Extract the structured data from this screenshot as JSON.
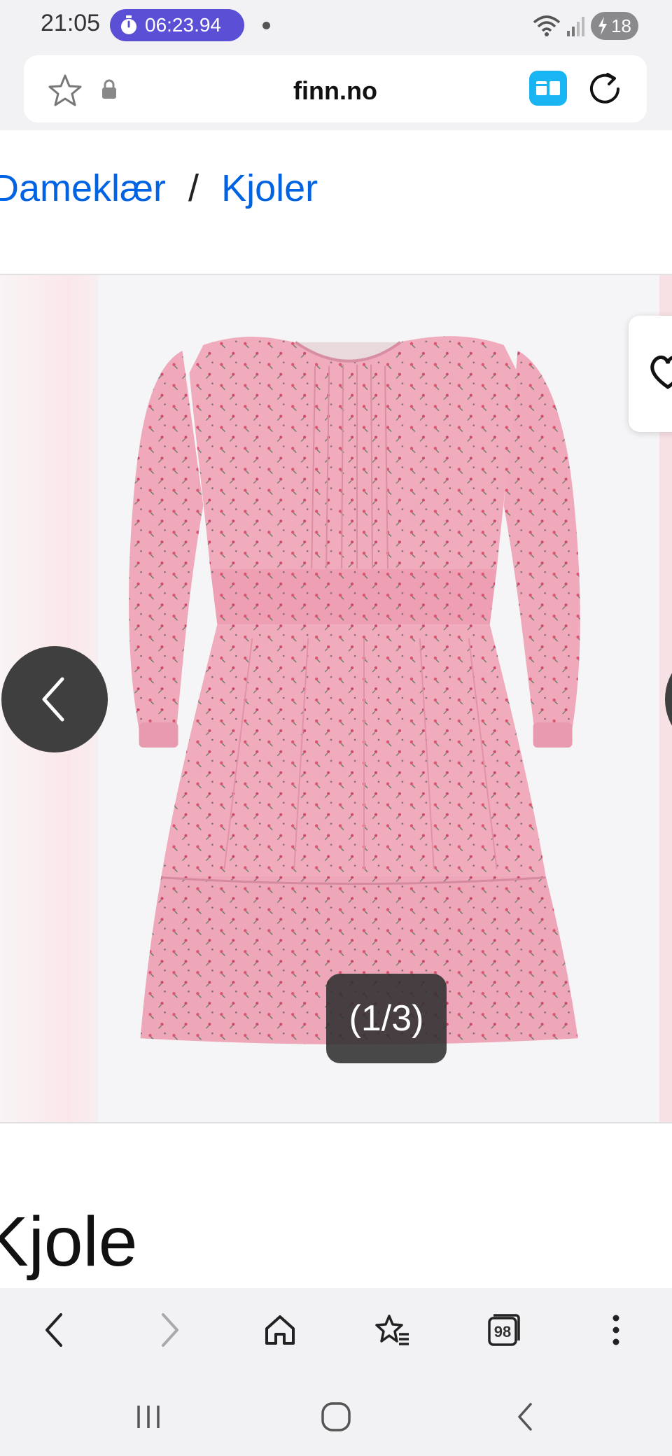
{
  "status_bar": {
    "time": "21:05",
    "timer": "06:23.94",
    "battery": "18"
  },
  "browser": {
    "url": "finn.no",
    "tabs_count": "98"
  },
  "breadcrumb": {
    "items": [
      "Dameklær",
      "Kjoler"
    ],
    "separator": "/"
  },
  "gallery": {
    "counter": "(1/3)",
    "dress_color": "#efa9bb",
    "background": "#f5f4f6"
  },
  "ad": {
    "title": "Kjole"
  },
  "colors": {
    "link": "#0063e4",
    "accent_timer": "#5b4fd6",
    "reader_mode": "#19b4f2"
  },
  "icons": {
    "status": [
      "stopwatch-icon",
      "wifi-icon",
      "signal-icon",
      "battery-icon",
      "charging-icon"
    ],
    "toolbar": [
      "back-arrow-icon",
      "forward-arrow-icon",
      "home-icon",
      "bookmarks-icon",
      "tabs-icon",
      "more-icon"
    ],
    "system": [
      "recent-apps-icon",
      "home-circle-icon",
      "system-back-icon"
    ]
  }
}
